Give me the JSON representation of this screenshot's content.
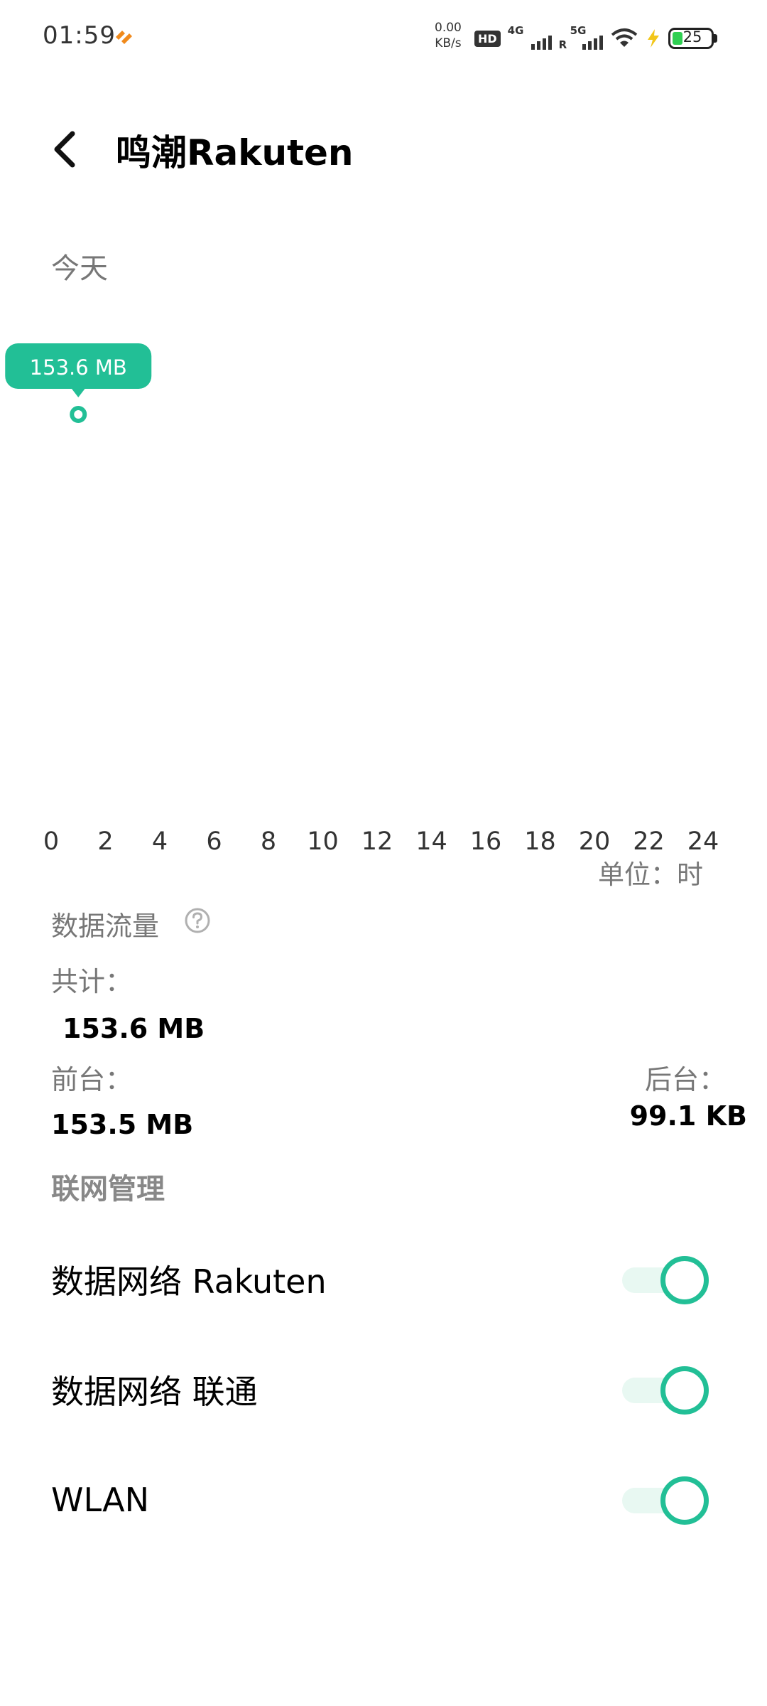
{
  "status_bar": {
    "time": "01:59",
    "speed_value": "0.00",
    "speed_unit": "KB/s",
    "hd_badge": "HD",
    "sim1_gen": "4G",
    "sim1_roaming": "R",
    "sim2_gen": "5G",
    "battery_level": "25",
    "battery_color": "#2fcf52"
  },
  "header": {
    "back_icon": "chevron-left-icon",
    "title": "鸣潮Rakuten"
  },
  "chart": {
    "period_label": "今天",
    "unit_label": "单位：时",
    "accent_color": "#22bf96"
  },
  "chart_data": {
    "type": "line",
    "x_ticks": [
      "0",
      "2",
      "4",
      "6",
      "8",
      "10",
      "12",
      "14",
      "16",
      "18",
      "20",
      "22",
      "24"
    ],
    "xlim": [
      0,
      24
    ],
    "points": [
      {
        "x": 1,
        "y": 153.6
      }
    ],
    "highlight_label": "153.6 MB",
    "grid": false
  },
  "usage": {
    "section_title": "数据流量",
    "help_icon": "question-circle-icon",
    "total_label": "共计：",
    "total_value": "153.6 MB",
    "foreground_label": "前台：",
    "foreground_value": "153.5 MB",
    "background_label": "后台：",
    "background_value": "99.1 KB"
  },
  "network": {
    "section_title": "联网管理",
    "items": [
      {
        "label": "数据网络 Rakuten",
        "enabled": true
      },
      {
        "label": "数据网络 联通",
        "enabled": true
      },
      {
        "label": "WLAN",
        "enabled": true
      }
    ]
  }
}
